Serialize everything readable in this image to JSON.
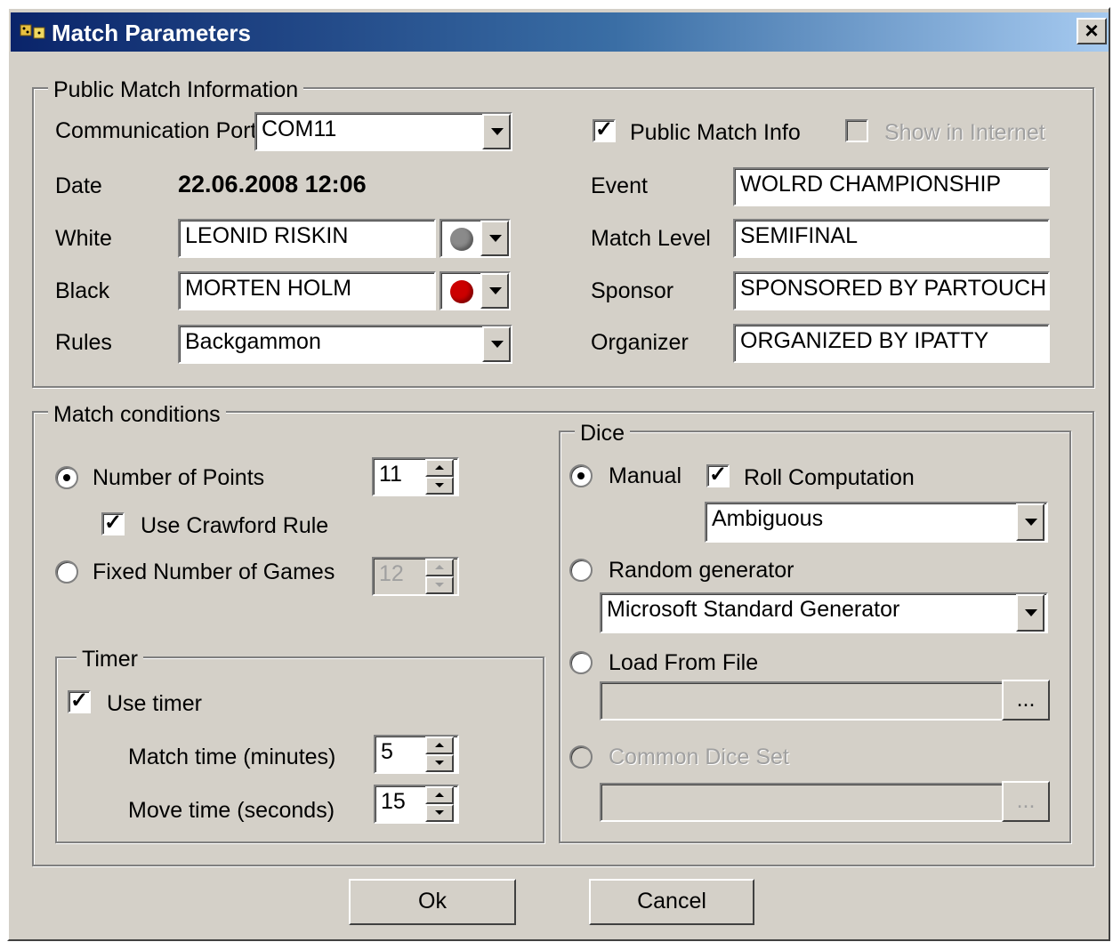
{
  "window": {
    "title": "Match Parameters",
    "close_label": "×"
  },
  "public_info": {
    "group_label": "Public Match Information",
    "comm_port_label": "Communication Port",
    "comm_port_value": "COM11",
    "public_match_info_label": "Public Match Info",
    "public_match_info_checked": true,
    "show_internet_label": "Show in Internet",
    "show_internet_checked": false,
    "date_label": "Date",
    "date_value": "22.06.2008 12:06",
    "white_label": "White",
    "white_value": "LEONID RISKIN",
    "white_color": "#8a8a8a",
    "black_label": "Black",
    "black_value": "MORTEN HOLM",
    "black_color": "#cc0000",
    "rules_label": "Rules",
    "rules_value": "Backgammon",
    "event_label": "Event",
    "event_value": "WOLRD CHAMPIONSHIP",
    "match_level_label": "Match Level",
    "match_level_value": "SEMIFINAL",
    "sponsor_label": "Sponsor",
    "sponsor_value": "SPONSORED BY PARTOUCH",
    "organizer_label": "Organizer",
    "organizer_value": "ORGANIZED BY IPATTY"
  },
  "conditions": {
    "group_label": "Match conditions",
    "number_of_points_label": "Number of Points",
    "number_of_points_value": "11",
    "number_of_points_selected": true,
    "crawford_label": "Use Crawford Rule",
    "crawford_checked": true,
    "fixed_games_label": "Fixed Number of Games",
    "fixed_games_value": "12",
    "fixed_games_selected": false
  },
  "timer": {
    "group_label": "Timer",
    "use_timer_label": "Use timer",
    "use_timer_checked": true,
    "match_time_label": "Match time (minutes)",
    "match_time_value": "5",
    "move_time_label": "Move time (seconds)",
    "move_time_value": "15"
  },
  "dice": {
    "group_label": "Dice",
    "manual_label": "Manual",
    "manual_selected": true,
    "roll_computation_label": "Roll Computation",
    "roll_computation_checked": true,
    "roll_mode_value": "Ambiguous",
    "random_label": "Random generator",
    "random_selected": false,
    "generator_value": "Microsoft Standard Generator",
    "load_file_label": "Load From File",
    "load_file_selected": false,
    "load_file_path": "",
    "browse_label": "...",
    "common_dice_label": "Common Dice Set",
    "common_dice_path": "",
    "browse2_label": "..."
  },
  "buttons": {
    "ok_label": "Ok",
    "cancel_label": "Cancel"
  }
}
